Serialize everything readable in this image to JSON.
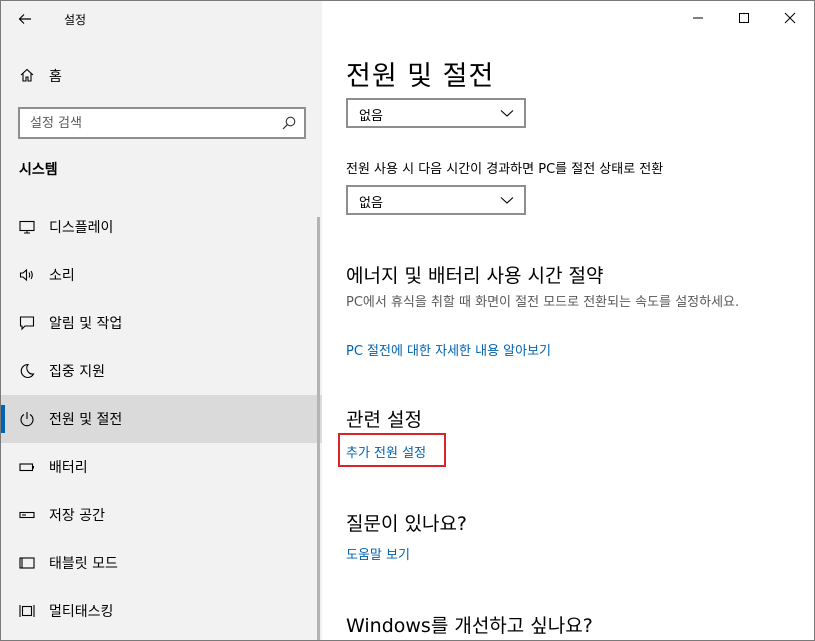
{
  "app": {
    "title": "설정"
  },
  "sidebar": {
    "home_label": "홈",
    "search_placeholder": "설정 검색",
    "section": "시스템",
    "items": [
      {
        "label": "디스플레이",
        "icon": "monitor-icon"
      },
      {
        "label": "소리",
        "icon": "speaker-icon"
      },
      {
        "label": "알림 및 작업",
        "icon": "notification-icon"
      },
      {
        "label": "집중 지원",
        "icon": "moon-icon"
      },
      {
        "label": "전원 및 절전",
        "icon": "power-icon",
        "active": true
      },
      {
        "label": "배터리",
        "icon": "battery-icon"
      },
      {
        "label": "저장 공간",
        "icon": "storage-icon"
      },
      {
        "label": "태블릿 모드",
        "icon": "tablet-icon"
      },
      {
        "label": "멀티태스킹",
        "icon": "multitasking-icon"
      }
    ]
  },
  "main": {
    "title": "전원 및 절전",
    "dropdown1_value": "없음",
    "sleep_label": "전원 사용 시 다음 시간이 경과하면 PC를 절전 상태로 전환",
    "dropdown2_value": "없음",
    "energy": {
      "heading": "에너지 및 배터리 사용 시간 절약",
      "description": "PC에서 휴식을 취할 때 화면이 절전 모드로 전환되는 속도를 설정하세요.",
      "link": "PC 절전에 대한 자세한 내용 알아보기"
    },
    "related": {
      "heading": "관련 설정",
      "link": "추가 전원 설정"
    },
    "question": {
      "heading": "질문이 있나요?",
      "link": "도움말 보기"
    },
    "improve": {
      "heading": "Windows를 개선하고 싶나요?"
    }
  },
  "colors": {
    "accent": "#0063b1",
    "highlight": "#d6262b",
    "sidebar_bg": "#f2f2f2"
  }
}
